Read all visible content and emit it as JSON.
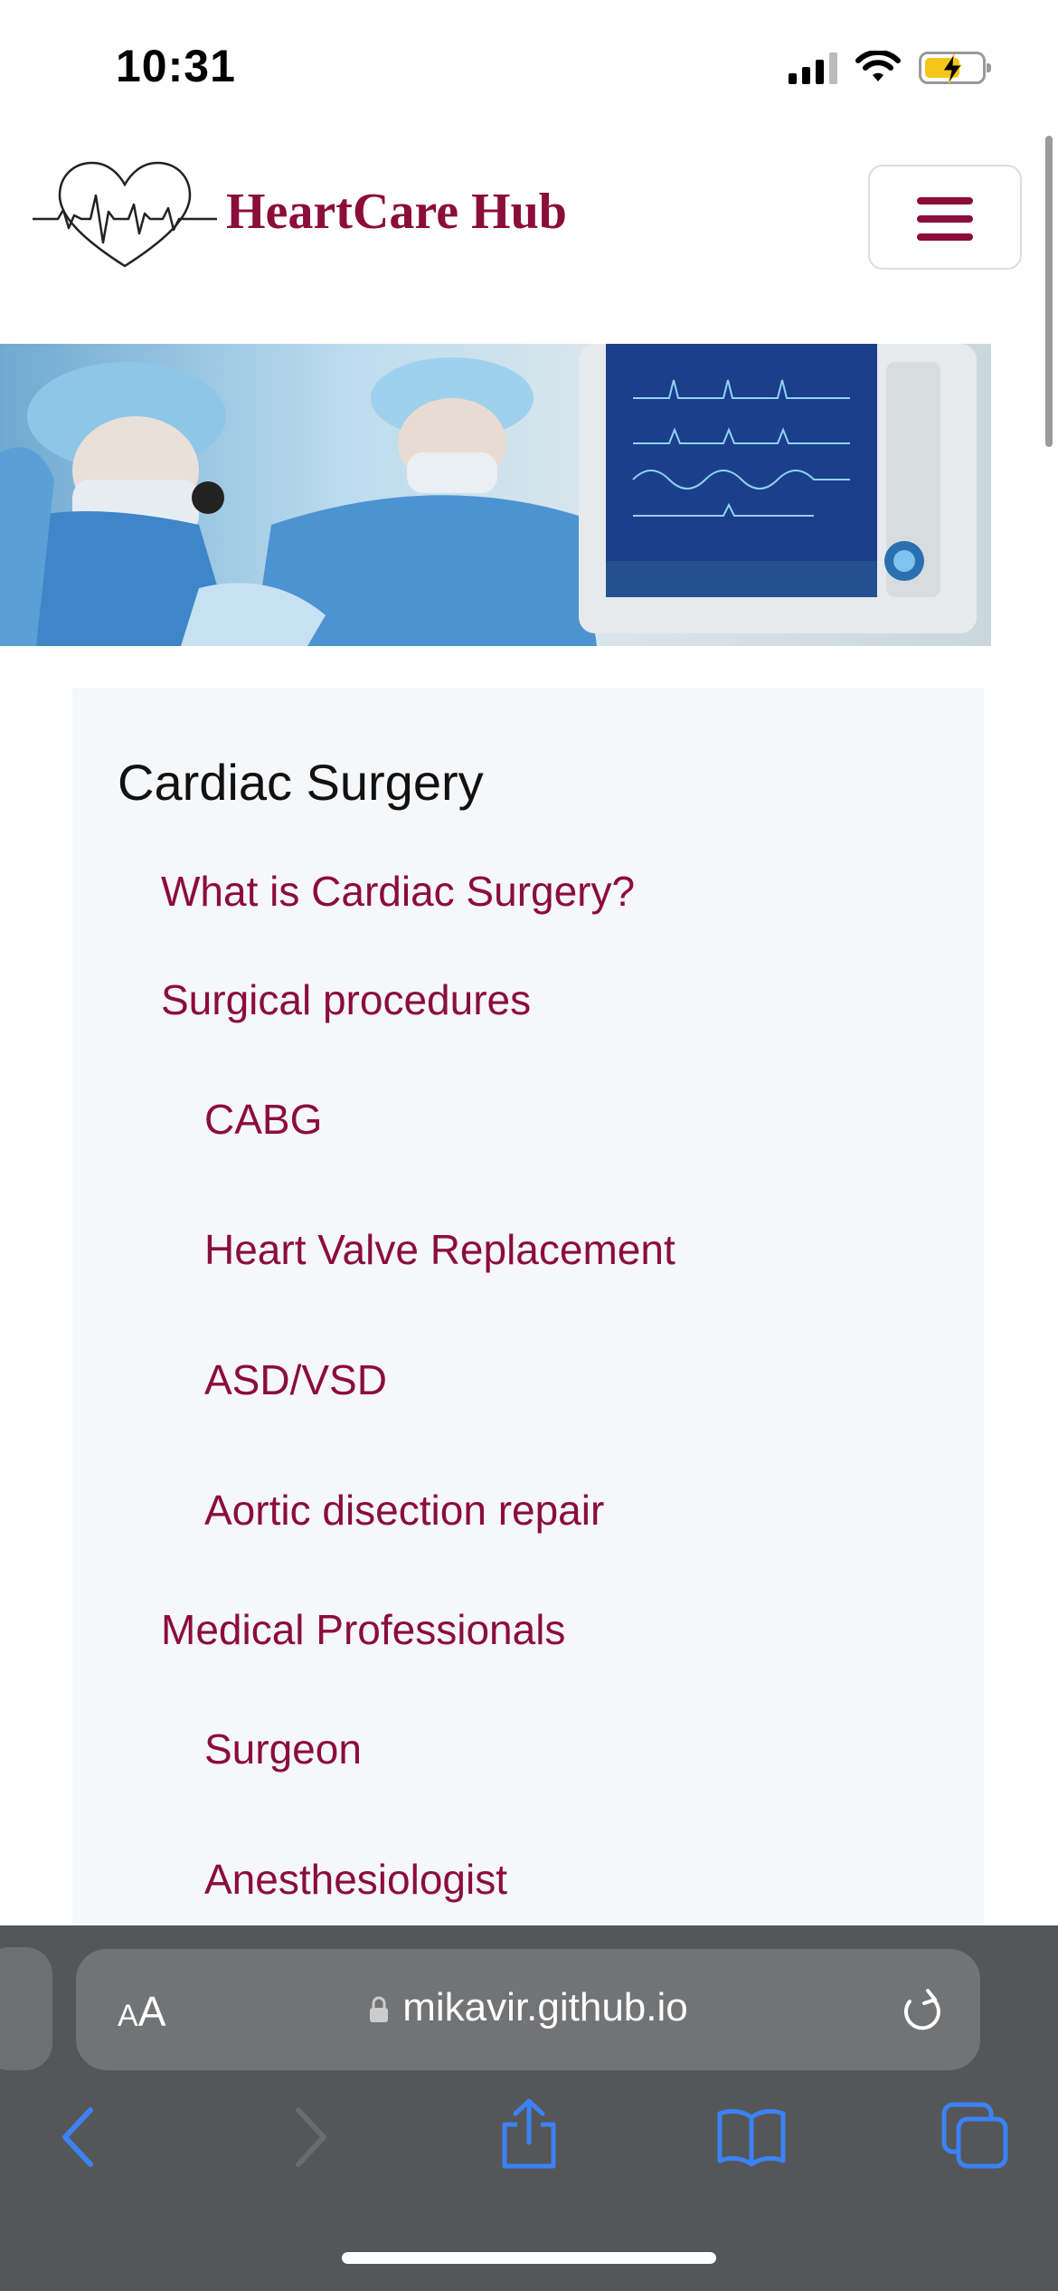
{
  "status_bar": {
    "time": "10:31"
  },
  "header": {
    "brand": "HeartCare Hub"
  },
  "card": {
    "title": "Cardiac Surgery",
    "links": [
      {
        "label": "What is Cardiac Surgery?",
        "level": 1
      },
      {
        "label": "Surgical procedures",
        "level": 1
      },
      {
        "label": "CABG",
        "level": 2
      },
      {
        "label": "Heart Valve Replacement",
        "level": 2
      },
      {
        "label": "ASD/VSD",
        "level": 2
      },
      {
        "label": "Aortic disection repair",
        "level": 2
      },
      {
        "label": "Medical Professionals",
        "level": 1
      },
      {
        "label": "Surgeon",
        "level": 2
      },
      {
        "label": "Anesthesiologist",
        "level": 2
      }
    ]
  },
  "browser": {
    "text_size_button": "AA",
    "url": "mikavir.github.io"
  },
  "colors": {
    "brand": "#8b0d3a",
    "accent": "#2f7cf6",
    "toolbar": "#555657"
  },
  "icons": [
    "signal-icon",
    "wifi-icon",
    "battery-charging-icon",
    "heart-ecg-logo-icon",
    "hamburger-menu-icon",
    "lock-icon",
    "reload-icon",
    "back-chevron-icon",
    "forward-chevron-icon",
    "share-icon",
    "bookmarks-icon",
    "tabs-icon"
  ]
}
